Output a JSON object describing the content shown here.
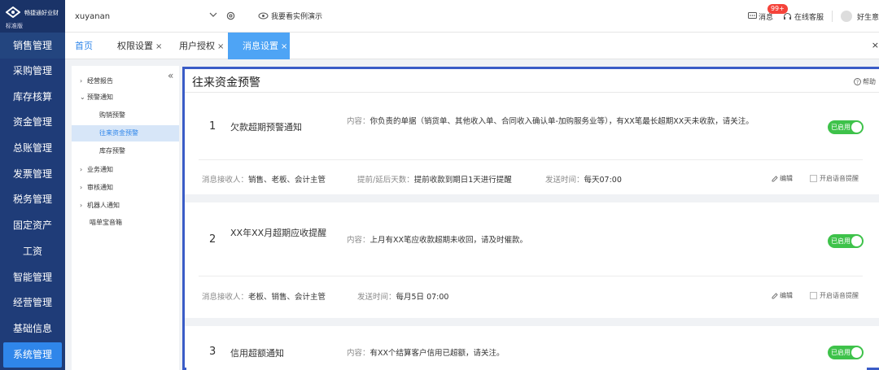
{
  "sidebar": {
    "brand": "畅捷通好业财",
    "edition": "标准版",
    "items": [
      {
        "label": "销售管理"
      },
      {
        "label": "采购管理"
      },
      {
        "label": "库存核算"
      },
      {
        "label": "资金管理"
      },
      {
        "label": "总账管理"
      },
      {
        "label": "发票管理"
      },
      {
        "label": "税务管理"
      },
      {
        "label": "固定资产"
      },
      {
        "label": "工资"
      },
      {
        "label": "智能管理"
      },
      {
        "label": "经营管理"
      },
      {
        "label": "基础信息"
      },
      {
        "label": "系统管理"
      }
    ]
  },
  "topbar": {
    "account": "xuyanan",
    "demo": "我要看实例演示",
    "message": "消息",
    "badge": "99+",
    "service": "在线客服",
    "user": "好生意"
  },
  "tabs": [
    {
      "label": "首页"
    },
    {
      "label": "权限设置"
    },
    {
      "label": "用户授权"
    },
    {
      "label": "消息设置"
    }
  ],
  "tab_close": "×",
  "tree": {
    "collapse": "«",
    "nodes": [
      {
        "label": "经营报告",
        "caret": "›"
      },
      {
        "label": "预警通知",
        "caret": "⌄"
      },
      {
        "label": "购销预警"
      },
      {
        "label": "往来资金预警"
      },
      {
        "label": "库存预警"
      },
      {
        "label": "业务通知",
        "caret": "›"
      },
      {
        "label": "审核通知",
        "caret": "›"
      },
      {
        "label": "机器人通知",
        "caret": "›"
      },
      {
        "label": "喵单宝音箱"
      }
    ]
  },
  "panel": {
    "title": "往来资金预警",
    "help": "帮助",
    "content_label": "内容：",
    "receivers_label": "消息接收人：",
    "advance_label": "提前/延后天数：",
    "send_label": "发送时间：",
    "toggle_label": "已启用",
    "edit_label": "编辑",
    "voice_label": "开启语音提醒",
    "cards": [
      {
        "num": "1",
        "name": "欠款超期预警通知",
        "content": "你负责的单据（销货单、其他收入单、合同收入确认单-加购服务业等），有XX笔最长超期XX天未收款，请关注。",
        "receivers": "销售、老板、会计主管",
        "advance": "提前收款到期日1天进行提醒",
        "send_time": "每天07:00"
      },
      {
        "num": "2",
        "name": "XX年XX月超期应收提醒",
        "content": "上月有XX笔应收款超期未收回，请及时催款。",
        "receivers": "老板、销售、会计主管",
        "send_time": "每月5日 07:00"
      },
      {
        "num": "3",
        "name": "信用超额通知",
        "content": "有XX个结算客户信用已超额，请关注。"
      }
    ]
  },
  "colors": {
    "sidebar": "#1f3c78",
    "active_menu": "#2f86ea",
    "active_tab": "#4ea4f5",
    "toggle_on": "#3ec24a",
    "highlight_border": "#3a5cc7",
    "badge": "#f5433a"
  },
  "icons": [
    "logo-icon",
    "chevron-down-icon",
    "gear-icon",
    "eye-icon",
    "message-icon",
    "headset-icon",
    "avatar-icon",
    "help-icon",
    "edit-icon"
  ]
}
